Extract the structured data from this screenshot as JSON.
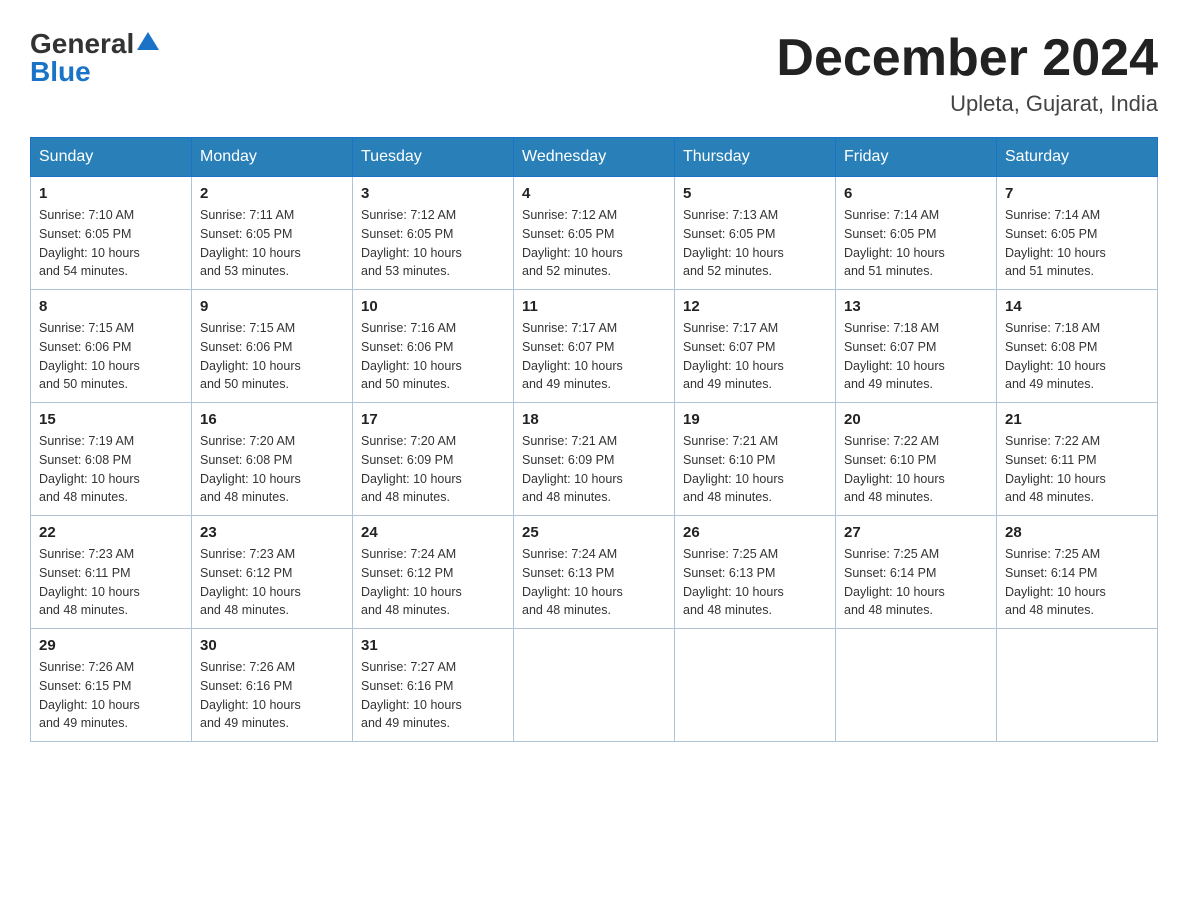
{
  "logo": {
    "general": "General",
    "blue": "Blue"
  },
  "title": {
    "month_year": "December 2024",
    "location": "Upleta, Gujarat, India"
  },
  "weekdays": [
    "Sunday",
    "Monday",
    "Tuesday",
    "Wednesday",
    "Thursday",
    "Friday",
    "Saturday"
  ],
  "weeks": [
    [
      {
        "day": "1",
        "sunrise": "7:10 AM",
        "sunset": "6:05 PM",
        "daylight": "10 hours and 54 minutes."
      },
      {
        "day": "2",
        "sunrise": "7:11 AM",
        "sunset": "6:05 PM",
        "daylight": "10 hours and 53 minutes."
      },
      {
        "day": "3",
        "sunrise": "7:12 AM",
        "sunset": "6:05 PM",
        "daylight": "10 hours and 53 minutes."
      },
      {
        "day": "4",
        "sunrise": "7:12 AM",
        "sunset": "6:05 PM",
        "daylight": "10 hours and 52 minutes."
      },
      {
        "day": "5",
        "sunrise": "7:13 AM",
        "sunset": "6:05 PM",
        "daylight": "10 hours and 52 minutes."
      },
      {
        "day": "6",
        "sunrise": "7:14 AM",
        "sunset": "6:05 PM",
        "daylight": "10 hours and 51 minutes."
      },
      {
        "day": "7",
        "sunrise": "7:14 AM",
        "sunset": "6:05 PM",
        "daylight": "10 hours and 51 minutes."
      }
    ],
    [
      {
        "day": "8",
        "sunrise": "7:15 AM",
        "sunset": "6:06 PM",
        "daylight": "10 hours and 50 minutes."
      },
      {
        "day": "9",
        "sunrise": "7:15 AM",
        "sunset": "6:06 PM",
        "daylight": "10 hours and 50 minutes."
      },
      {
        "day": "10",
        "sunrise": "7:16 AM",
        "sunset": "6:06 PM",
        "daylight": "10 hours and 50 minutes."
      },
      {
        "day": "11",
        "sunrise": "7:17 AM",
        "sunset": "6:07 PM",
        "daylight": "10 hours and 49 minutes."
      },
      {
        "day": "12",
        "sunrise": "7:17 AM",
        "sunset": "6:07 PM",
        "daylight": "10 hours and 49 minutes."
      },
      {
        "day": "13",
        "sunrise": "7:18 AM",
        "sunset": "6:07 PM",
        "daylight": "10 hours and 49 minutes."
      },
      {
        "day": "14",
        "sunrise": "7:18 AM",
        "sunset": "6:08 PM",
        "daylight": "10 hours and 49 minutes."
      }
    ],
    [
      {
        "day": "15",
        "sunrise": "7:19 AM",
        "sunset": "6:08 PM",
        "daylight": "10 hours and 48 minutes."
      },
      {
        "day": "16",
        "sunrise": "7:20 AM",
        "sunset": "6:08 PM",
        "daylight": "10 hours and 48 minutes."
      },
      {
        "day": "17",
        "sunrise": "7:20 AM",
        "sunset": "6:09 PM",
        "daylight": "10 hours and 48 minutes."
      },
      {
        "day": "18",
        "sunrise": "7:21 AM",
        "sunset": "6:09 PM",
        "daylight": "10 hours and 48 minutes."
      },
      {
        "day": "19",
        "sunrise": "7:21 AM",
        "sunset": "6:10 PM",
        "daylight": "10 hours and 48 minutes."
      },
      {
        "day": "20",
        "sunrise": "7:22 AM",
        "sunset": "6:10 PM",
        "daylight": "10 hours and 48 minutes."
      },
      {
        "day": "21",
        "sunrise": "7:22 AM",
        "sunset": "6:11 PM",
        "daylight": "10 hours and 48 minutes."
      }
    ],
    [
      {
        "day": "22",
        "sunrise": "7:23 AM",
        "sunset": "6:11 PM",
        "daylight": "10 hours and 48 minutes."
      },
      {
        "day": "23",
        "sunrise": "7:23 AM",
        "sunset": "6:12 PM",
        "daylight": "10 hours and 48 minutes."
      },
      {
        "day": "24",
        "sunrise": "7:24 AM",
        "sunset": "6:12 PM",
        "daylight": "10 hours and 48 minutes."
      },
      {
        "day": "25",
        "sunrise": "7:24 AM",
        "sunset": "6:13 PM",
        "daylight": "10 hours and 48 minutes."
      },
      {
        "day": "26",
        "sunrise": "7:25 AM",
        "sunset": "6:13 PM",
        "daylight": "10 hours and 48 minutes."
      },
      {
        "day": "27",
        "sunrise": "7:25 AM",
        "sunset": "6:14 PM",
        "daylight": "10 hours and 48 minutes."
      },
      {
        "day": "28",
        "sunrise": "7:25 AM",
        "sunset": "6:14 PM",
        "daylight": "10 hours and 48 minutes."
      }
    ],
    [
      {
        "day": "29",
        "sunrise": "7:26 AM",
        "sunset": "6:15 PM",
        "daylight": "10 hours and 49 minutes."
      },
      {
        "day": "30",
        "sunrise": "7:26 AM",
        "sunset": "6:16 PM",
        "daylight": "10 hours and 49 minutes."
      },
      {
        "day": "31",
        "sunrise": "7:27 AM",
        "sunset": "6:16 PM",
        "daylight": "10 hours and 49 minutes."
      },
      null,
      null,
      null,
      null
    ]
  ],
  "labels": {
    "sunrise": "Sunrise:",
    "sunset": "Sunset:",
    "daylight": "Daylight:"
  }
}
